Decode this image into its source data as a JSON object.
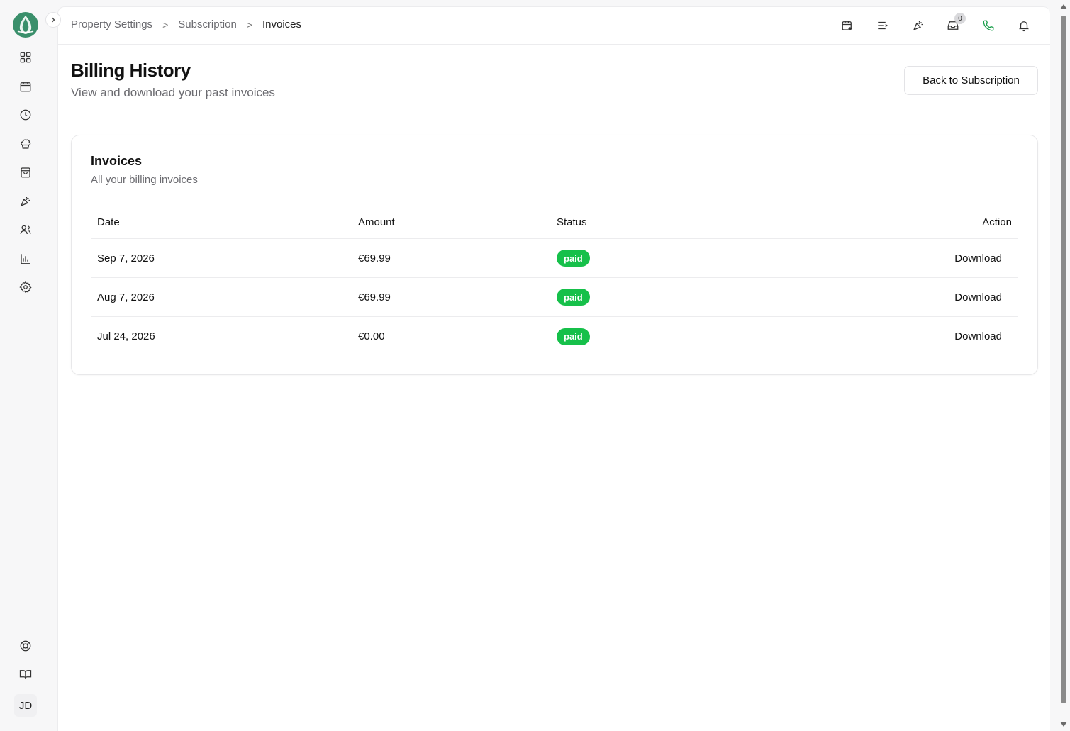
{
  "breadcrumb": {
    "items": [
      "Property Settings",
      "Subscription",
      "Invoices"
    ],
    "separator": ">"
  },
  "header": {
    "inbox_count": "0"
  },
  "page": {
    "title": "Billing History",
    "subtitle": "View and download your past invoices",
    "back_button": "Back to Subscription"
  },
  "card": {
    "title": "Invoices",
    "subtitle": "All your billing invoices"
  },
  "table": {
    "columns": [
      "Date",
      "Amount",
      "Status",
      "Action"
    ],
    "rows": [
      {
        "date": "Sep 7, 2026",
        "amount": "€69.99",
        "status": "paid",
        "action": "Download"
      },
      {
        "date": "Aug 7, 2026",
        "amount": "€69.99",
        "status": "paid",
        "action": "Download"
      },
      {
        "date": "Jul 24, 2026",
        "amount": "€0.00",
        "status": "paid",
        "action": "Download"
      }
    ]
  },
  "user": {
    "initials": "JD"
  },
  "colors": {
    "accent_green": "#16c04a",
    "phone_green": "#1a9e4b"
  },
  "icons": {
    "sidebar": [
      "dashboard-icon",
      "calendar-icon",
      "clock-icon",
      "chef-hat-icon",
      "shopping-bag-icon",
      "party-popper-icon",
      "users-icon",
      "bar-chart-icon",
      "gear-icon"
    ],
    "sidebar_bottom": [
      "lifebuoy-icon",
      "book-icon"
    ],
    "topbar": [
      "calendar-add-icon",
      "list-arrow-icon",
      "party-popper-icon",
      "inbox-icon",
      "phone-icon",
      "bell-icon"
    ]
  }
}
